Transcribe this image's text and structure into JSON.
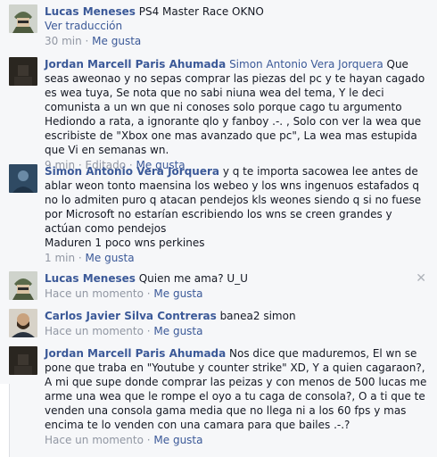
{
  "comments": [
    {
      "author": "Lucas Meneses",
      "text": " PS4 Master Race OKNO",
      "translate": "Ver traducción",
      "time": "30 min",
      "dot": " · ",
      "like": "Me gusta"
    },
    {
      "author": "Jordan Marcell Paris Ahumada",
      "mention": "Simon Antonio Vera Jorquera",
      "text": " Que seas aweonao y no sepas comprar las piezas del pc y te hayan cagado es wea tuya, Se nota que no sabi niuna wea del tema, Y le deci comunista a un wn que ni conoses solo porque cago tu argumento Hediondo a rata, a ignorante qlo y fanboy .-. , Solo con ver la wea que escribiste de \"Xbox one mas avanzado que pc\", La wea mas estupida que Vi en semanas wn.",
      "time": "9 min",
      "edited": "Editado",
      "dot": " · ",
      "like": "Me gusta"
    },
    {
      "author": "Simon Antonio Vera Jorquera",
      "text": " y q te importa sacowea lee antes de ablar weon tonto maensina los webeo y los wns ingenuos estafados q no lo admiten puro q atacan pendejos kls weones siendo q si no fuese por Microsoft no estarían escribiendo los wns se creen grandes y actúan como pendejos",
      "text2": "Maduren 1 poco wns perkines",
      "time": "1 min",
      "dot": " · ",
      "like": "Me gusta"
    },
    {
      "author": "Lucas Meneses",
      "text": " Quien me ama? U_U",
      "time": "Hace un momento",
      "dot": " · ",
      "like": "Me gusta"
    },
    {
      "author": "Carlos Javier Silva Contreras",
      "text": " banea2 simon",
      "time": "Hace un momento",
      "dot": " · ",
      "like": "Me gusta"
    },
    {
      "author": "Jordan Marcell Paris Ahumada",
      "text": " Nos dice que maduremos, El wn se pone que traba en \"Youtube y counter strike\" XD, Y a quien cagaraon?, A mi que supe donde comprar las peizas y con menos de 500 lucas me arme una wea que le rompe el oyo a tu caga de consola?, O a ti que te venden una consola gama media que no llega ni a los 60 fps y mas encima te lo venden con una camara para que bailes .-.?",
      "time": "Hace un momento",
      "dot": " · ",
      "like": "Me gusta"
    }
  ],
  "close_glyph": "✕",
  "colors": {
    "link": "#3b5998",
    "meta": "#9197a3",
    "text": "#141823",
    "bg": "#f6f7f9"
  },
  "icons": [
    "avatar-soldier",
    "avatar-dark",
    "avatar-blue",
    "avatar-soldier",
    "avatar-bearded",
    "avatar-dark"
  ]
}
